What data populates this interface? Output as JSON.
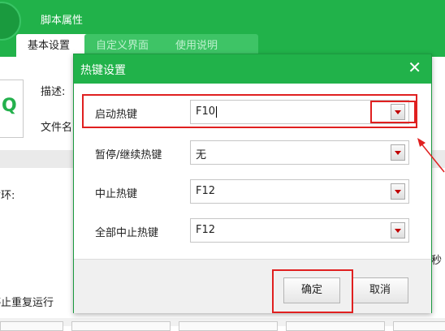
{
  "background_window": {
    "title": "脚本属性",
    "tabs": [
      "基本设置",
      "自定义界面",
      "使用说明"
    ],
    "labels": {
      "description": "描述:",
      "filename": "文件名",
      "loop": "循环:",
      "stop_repeat": "停止重复运行",
      "seconds_fragment": "秒"
    }
  },
  "dialog": {
    "title": "热键设置",
    "close_glyph": "✕",
    "rows": [
      {
        "label": "启动热键",
        "value": "F10"
      },
      {
        "label": "暂停/继续热键",
        "value": "无"
      },
      {
        "label": "中止热键",
        "value": "F12"
      },
      {
        "label": "全部中止热键",
        "value": "F12"
      }
    ],
    "buttons": {
      "ok": "确定",
      "cancel": "取消"
    }
  },
  "colors": {
    "accent_green": "#21b24a",
    "annotation_red": "#e02020",
    "dropdown_arrow": "#c00000"
  },
  "icons": [
    "close-icon",
    "dropdown-arrow-icon",
    "script-file-icon"
  ]
}
